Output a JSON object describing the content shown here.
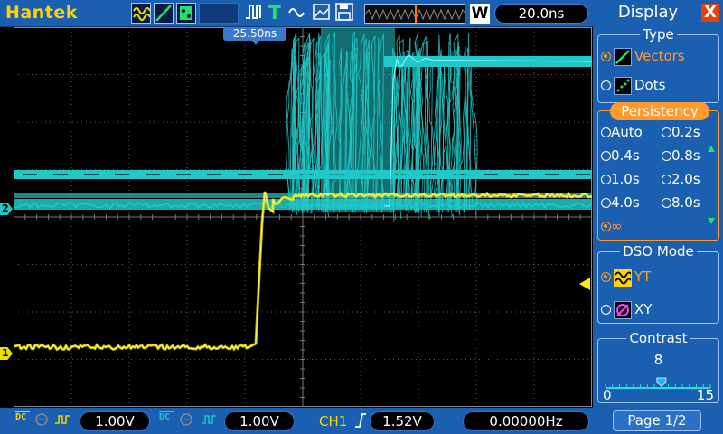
{
  "topbar": {
    "brand": "Hantek",
    "timebase": "20.0ns",
    "window_button": "W"
  },
  "screen": {
    "trigger_position_label": "25.50ns",
    "ch1_marker": "1",
    "ch2_marker": "2",
    "colors": {
      "ch1": "#e6e000",
      "ch2": "#20c8c8",
      "grid": "#5a5a5a"
    }
  },
  "bottombar": {
    "ch1_coupling": "DC",
    "ch1_volts": "1.00V",
    "ch2_coupling": "DC",
    "ch2_volts": "1.00V",
    "trigger_source": "CH1",
    "trigger_level": "1.52V",
    "frequency": "0.00000Hz"
  },
  "panel": {
    "title": "Display",
    "close": "X",
    "type": {
      "title": "Type",
      "options": [
        {
          "label": "Vectors",
          "selected": true
        },
        {
          "label": "Dots",
          "selected": false
        }
      ]
    },
    "persistency": {
      "title": "Persistency",
      "options": [
        "Auto",
        "0.2s",
        "0.4s",
        "0.8s",
        "1.0s",
        "2.0s",
        "4.0s",
        "8.0s",
        "∞"
      ],
      "selected": "∞"
    },
    "dso_mode": {
      "title": "DSO Mode",
      "options": [
        {
          "label": "YT",
          "selected": true
        },
        {
          "label": "XY",
          "selected": false
        }
      ]
    },
    "contrast": {
      "title": "Contrast",
      "value": "8",
      "min": "0",
      "max": "15",
      "level": 8
    },
    "page": "Page 1/2"
  }
}
